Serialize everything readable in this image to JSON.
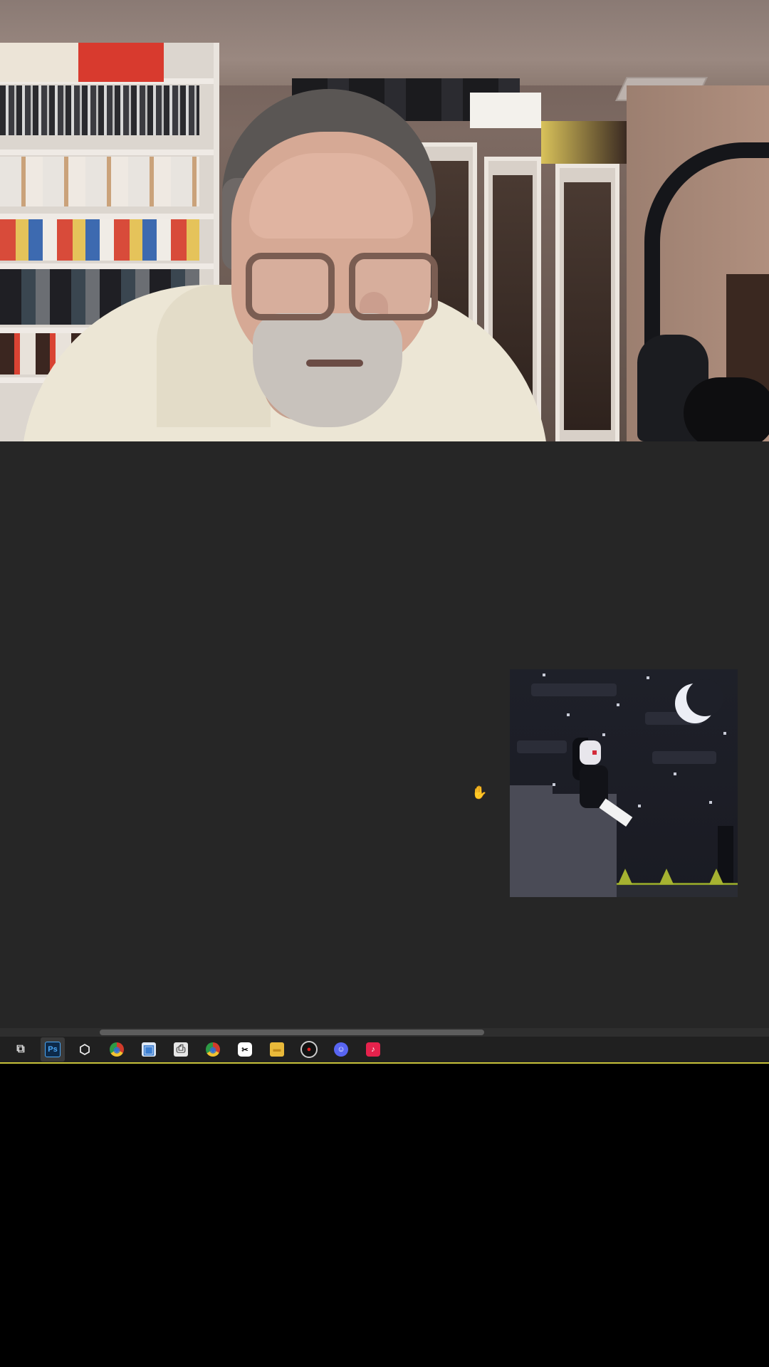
{
  "window": {
    "title": ""
  },
  "editor": {
    "background_color": "#262626"
  },
  "canvas": {
    "description_icon": "pixel-art-canvas"
  },
  "cursor": {
    "icon": "hand-grab-icon",
    "glyph": "✋"
  },
  "taskbar": {
    "accent_color": "#c7c23a",
    "items": [
      {
        "name": "task-view",
        "icon": "task-view-icon",
        "glyph": "⧉",
        "color": "#202020"
      },
      {
        "name": "photoshop",
        "icon": "photoshop-icon",
        "glyph": "Ps",
        "color": "#0d2a4a",
        "active": true
      },
      {
        "name": "3d-box",
        "icon": "cube-icon",
        "glyph": "⬡",
        "color": "#202020"
      },
      {
        "name": "chrome-alt",
        "icon": "chrome-icon",
        "glyph": "◉",
        "color": "#d23b2b"
      },
      {
        "name": "window-app",
        "icon": "window-icon",
        "glyph": "▣",
        "color": "#3c7fd2"
      },
      {
        "name": "printer-app",
        "icon": "printer-icon",
        "glyph": "⎙",
        "color": "#cfcfcf"
      },
      {
        "name": "chrome",
        "icon": "chrome-icon",
        "glyph": "◉",
        "color": "#2c9a45"
      },
      {
        "name": "capcut",
        "icon": "capcut-icon",
        "glyph": "✂",
        "color": "#ffffff"
      },
      {
        "name": "file-explorer",
        "icon": "folder-icon",
        "glyph": "▬",
        "color": "#e9b93a"
      },
      {
        "name": "obs",
        "icon": "record-icon",
        "glyph": "●",
        "color": "#111111"
      },
      {
        "name": "discord",
        "icon": "discord-icon",
        "glyph": "☺",
        "color": "#5865f2"
      },
      {
        "name": "tiktok",
        "icon": "tiktok-icon",
        "glyph": "♪",
        "color": "#e5224c"
      }
    ]
  }
}
